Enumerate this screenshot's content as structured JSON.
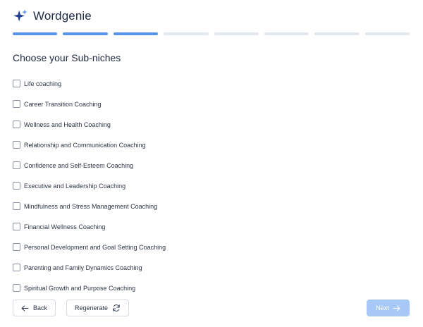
{
  "app": {
    "title": "Wordgenie",
    "logo_icon": "sparkles-icon",
    "accent": "#5b93e8"
  },
  "progress": {
    "total_steps": 8,
    "completed_steps": 3
  },
  "page": {
    "heading": "Choose your Sub-niches"
  },
  "options": [
    {
      "label": "Life coaching",
      "checked": false
    },
    {
      "label": "Career Transition Coaching",
      "checked": false
    },
    {
      "label": "Wellness and Health Coaching",
      "checked": false
    },
    {
      "label": "Relationship and Communication Coaching",
      "checked": false
    },
    {
      "label": "Confidence and Self-Esteem Coaching",
      "checked": false
    },
    {
      "label": "Executive and Leadership Coaching",
      "checked": false
    },
    {
      "label": "Mindfulness and Stress Management Coaching",
      "checked": false
    },
    {
      "label": "Financial Wellness Coaching",
      "checked": false
    },
    {
      "label": "Personal Development and Goal Setting Coaching",
      "checked": false
    },
    {
      "label": "Parenting and Family Dynamics Coaching",
      "checked": false
    },
    {
      "label": "Spiritual Growth and Purpose Coaching",
      "checked": false
    }
  ],
  "footer": {
    "back_label": "Back",
    "back_icon": "arrow-left-icon",
    "regenerate_label": "Regenerate",
    "regenerate_icon": "refresh-icon",
    "next_label": "Next",
    "next_icon": "arrow-right-icon",
    "next_disabled": true
  }
}
